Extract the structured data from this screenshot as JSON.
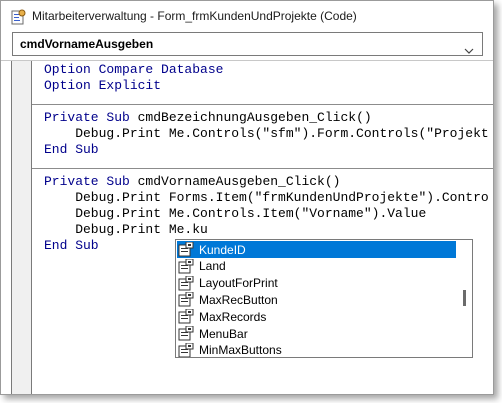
{
  "window": {
    "title": "Mitarbeiterverwaltung - Form_frmKundenUndProjekte (Code)"
  },
  "procedure_dropdown": {
    "value": "cmdVornameAusgeben"
  },
  "code": {
    "lines": [
      [
        {
          "t": "Option Compare Database",
          "k": true
        }
      ],
      [
        {
          "t": "Option Explicit",
          "k": true
        }
      ],
      [],
      [
        {
          "t": "Private Sub",
          "k": true
        },
        {
          "t": " cmdBezeichnungAusgeben_Click()"
        }
      ],
      [
        {
          "t": "    Debug.Print Me.Controls(\"sfm\").Form.Controls(\"Projekt"
        }
      ],
      [
        {
          "t": "End Sub",
          "k": true
        }
      ],
      [],
      [
        {
          "t": "Private Sub",
          "k": true
        },
        {
          "t": " cmdVornameAusgeben_Click()"
        }
      ],
      [
        {
          "t": "    Debug.Print Forms.Item(\"frmKundenUndProjekte\").Contro"
        }
      ],
      [
        {
          "t": "    Debug.Print Me.Controls.Item(\"Vorname\").Value"
        }
      ],
      [
        {
          "t": "    Debug.Print Me.ku"
        }
      ],
      [
        {
          "t": "End Sub",
          "k": true
        }
      ]
    ]
  },
  "autocomplete": {
    "selected_index": 0,
    "items": [
      {
        "label": "KundeID",
        "icon": "property-icon"
      },
      {
        "label": "Land",
        "icon": "property-icon"
      },
      {
        "label": "LayoutForPrint",
        "icon": "property-icon"
      },
      {
        "label": "MaxRecButton",
        "icon": "property-icon"
      },
      {
        "label": "MaxRecords",
        "icon": "property-icon"
      },
      {
        "label": "MenuBar",
        "icon": "property-icon"
      },
      {
        "label": "MinMaxButtons",
        "icon": "property-icon"
      }
    ]
  },
  "colors": {
    "keyword": "#00008b",
    "selection": "#0078d7",
    "text": "#000000"
  }
}
